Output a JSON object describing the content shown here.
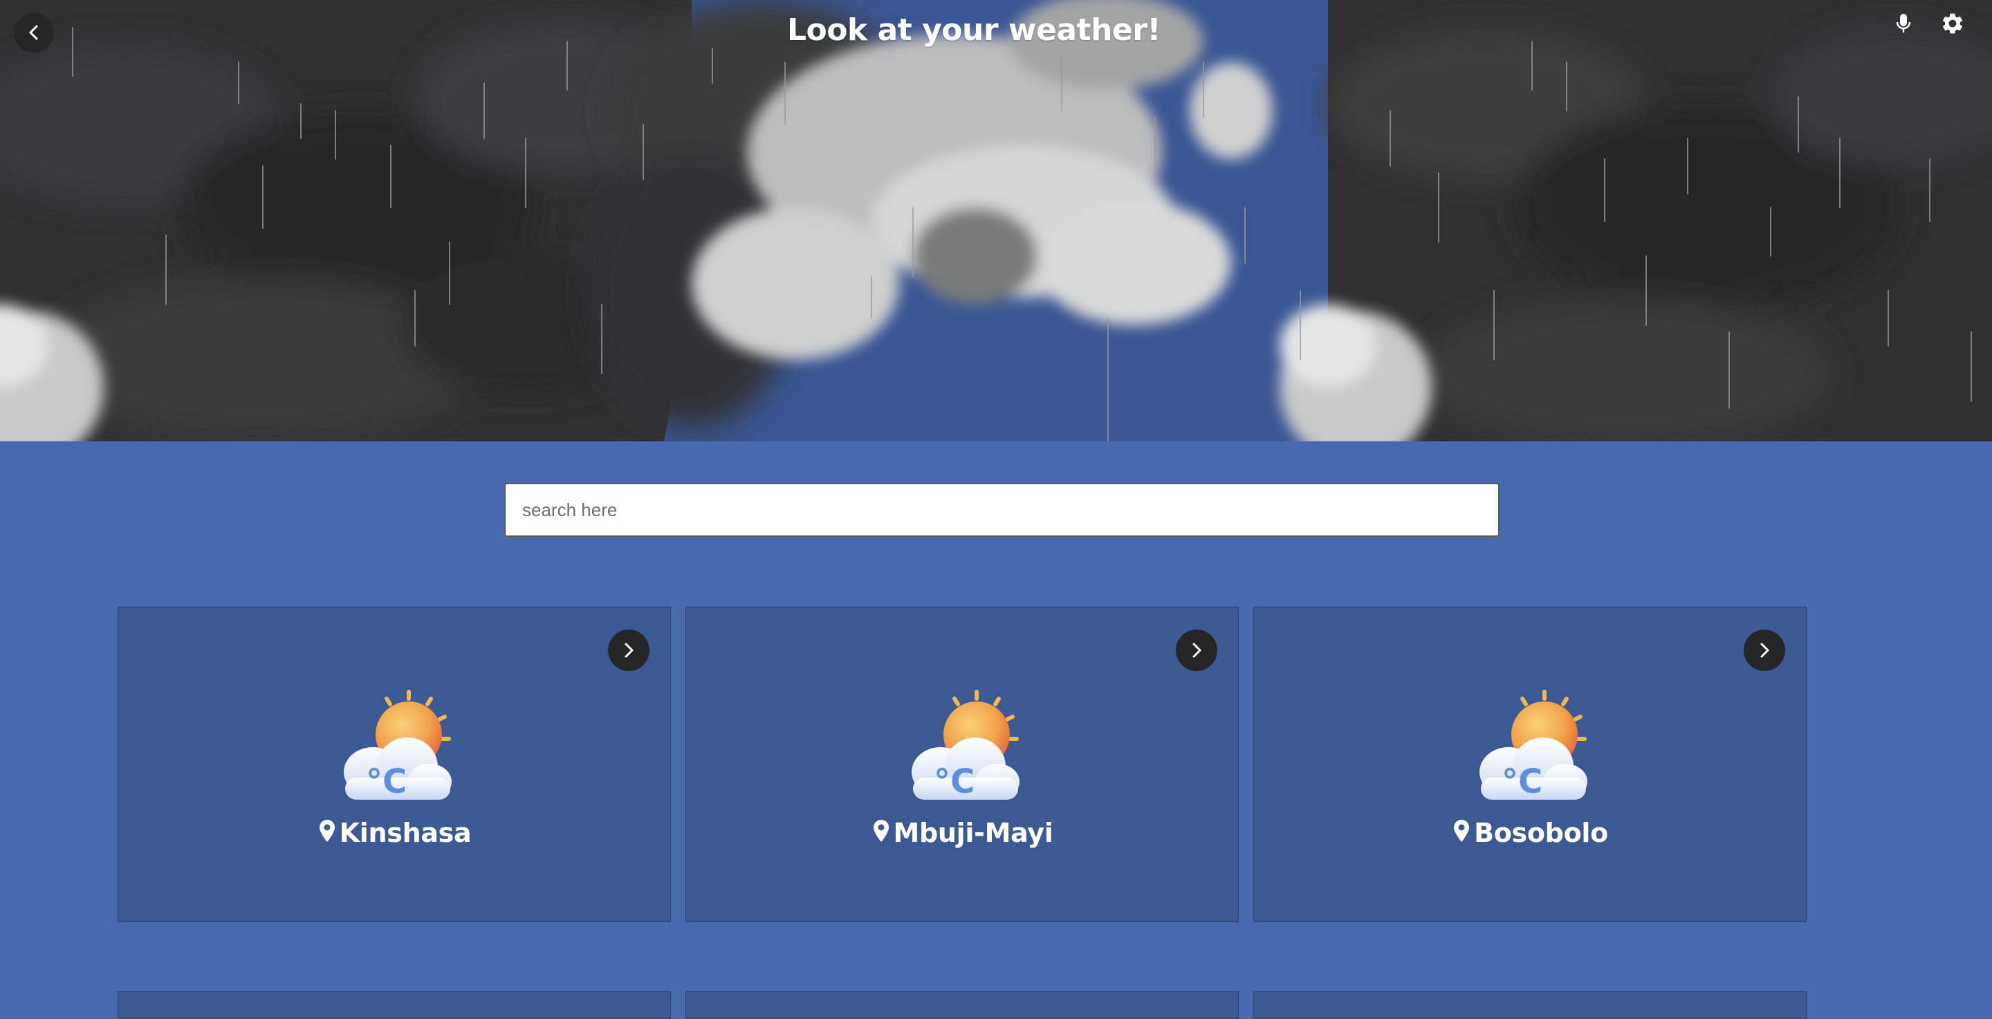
{
  "header": {
    "title": "Look at your weather!",
    "back_icon": "chevron-left-icon",
    "mic_icon": "microphone-icon",
    "settings_icon": "gear-icon"
  },
  "search": {
    "placeholder": "search here",
    "value": ""
  },
  "cities": [
    {
      "name": "Kinshasa",
      "icon": "partly-cloudy-celsius-icon"
    },
    {
      "name": "Mbuji-Mayi",
      "icon": "partly-cloudy-celsius-icon"
    },
    {
      "name": "Bosobolo",
      "icon": "partly-cloudy-celsius-icon"
    }
  ],
  "colors": {
    "page_background": "#4769ad",
    "card_background": "#3b5a93",
    "button_dark": "#262626",
    "sky_blue": "#3a5694"
  }
}
